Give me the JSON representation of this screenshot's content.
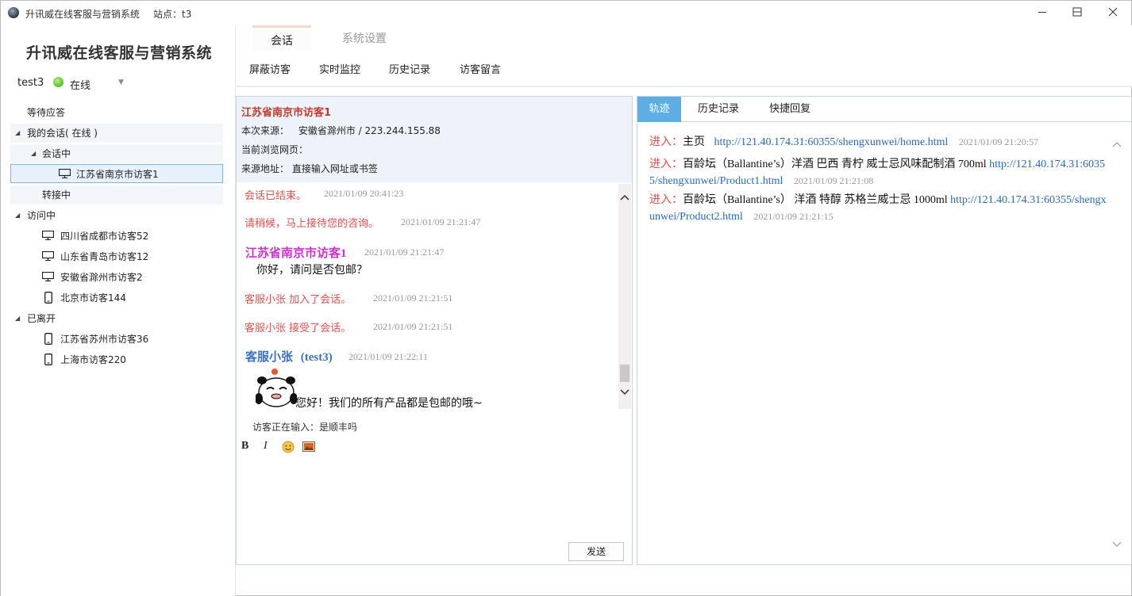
{
  "window": {
    "title": "升讯威在线客服与营销系统",
    "site": "站点：t3",
    "controls": {
      "minimize": "—",
      "maximize": "☐",
      "close": "✕"
    }
  },
  "sidebar": {
    "brand": "升讯威在线客服与营销系统",
    "user": "test3",
    "status": "在线",
    "status_color": "#54c02a",
    "tree": {
      "waiting": "等待应答",
      "my_sessions": "我的会话( 在线 )",
      "in_session": "会话中",
      "current_visitor": "江苏省南京市访客1",
      "transferring": "转接中",
      "visiting": "访问中",
      "visiting_items": [
        "四川省成都市访客52",
        "山东省青岛市访客12",
        "安徽省滁州市访客2",
        "北京市访客144"
      ],
      "left": "已离开",
      "left_items": [
        "江苏省苏州市访客36",
        "上海市访客220"
      ]
    }
  },
  "nav": {
    "main_tabs": [
      "会话",
      "系统设置"
    ],
    "sub_tabs": [
      "屏蔽访客",
      "实时监控",
      "历史记录",
      "访客留言"
    ]
  },
  "visitor": {
    "name": "江苏省南京市访客1",
    "source_label": "本次来源：",
    "source_value": "安徽省滁州市  /  223.244.155.88",
    "page_label": "当前浏览网页：",
    "page_value": "",
    "origin_label": "来源地址：",
    "origin_value": "直接输入网址或书签"
  },
  "messages": [
    {
      "text": "会话已结束。",
      "time": "2021/01/09 20:41:23"
    },
    {
      "text": "请稍候，马上接待您的咨询。",
      "time": "2021/01/09 21:21:47"
    },
    {
      "sender": "江苏省南京市访客1",
      "time": "2021/01/09 21:21:47",
      "body": "你好，请问是否包邮？"
    },
    {
      "text": "客服小张  加入了会话。",
      "time": "2021/01/09 21:21:51"
    },
    {
      "text": "客服小张  接受了会话。",
      "time": "2021/01/09 21:21:51"
    },
    {
      "sender": "客服小张",
      "sender_id": "(test3)",
      "time": "2021/01/09 21:22:11",
      "body": "您好！我们的所有产品都是包邮的哦~"
    }
  ],
  "composer": {
    "typing": "访客正在输入：是顺丰吗",
    "bold": "B",
    "italic": "I",
    "send": "发送"
  },
  "right_panel": {
    "tabs": [
      "轨迹",
      "历史记录",
      "快捷回复"
    ],
    "enter_label": "进入：",
    "tracks": [
      {
        "title": "主页",
        "url": "http://121.40.174.31:60355/shengxunwei/home.html",
        "time": "2021/01/09 21:20:57"
      },
      {
        "title": "百龄坛（Ballantine’s）洋酒  巴西  青柠  威士忌风味配制酒  700ml",
        "url": "http://121.40.174.31:60355/shengxunwei/Product1.html",
        "time": "2021/01/09 21:21:08"
      },
      {
        "title": "百龄坛（Ballantine’s）  洋酒  特醇  苏格兰威士忌  1000ml",
        "url": "http://121.40.174.31:60355/shengxunwei/Product2.html",
        "time": "2021/01/09 21:21:15"
      }
    ]
  }
}
